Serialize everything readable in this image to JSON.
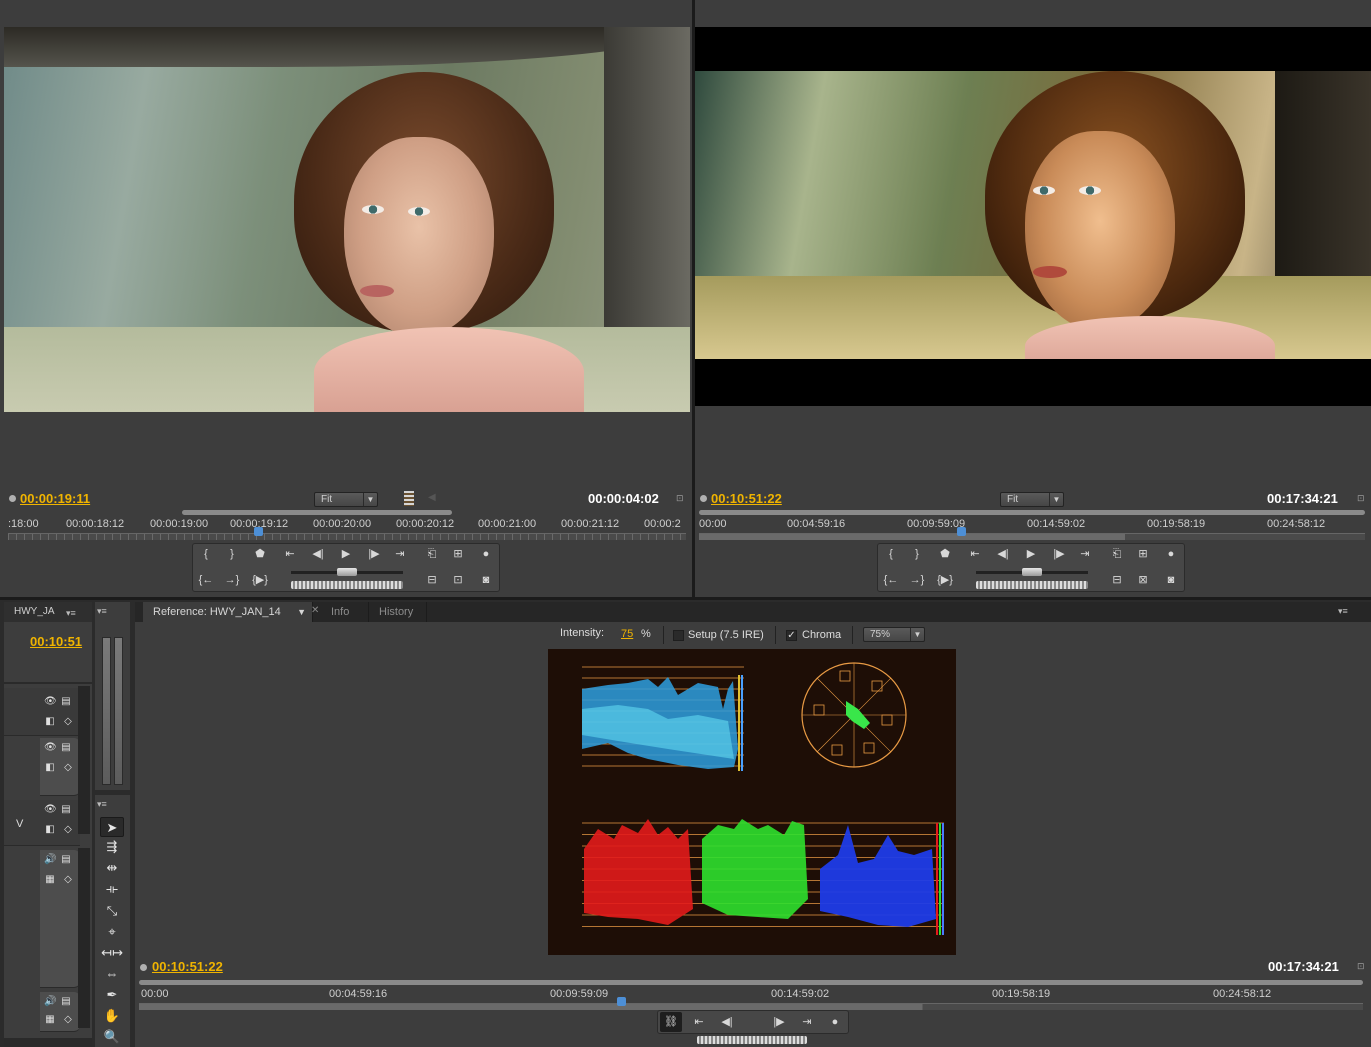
{
  "colors": {
    "accent_timecode": "#f0b400",
    "playhead": "#4d8fd6",
    "scope_bg": "#1e0e06",
    "scope_grid": "#e89a44",
    "luma_wave": "#37c8f0",
    "red_wave": "#e21b1b",
    "green_wave": "#2ee02e",
    "blue_wave": "#1f3ce8"
  },
  "source_monitor": {
    "current_timecode": "00:00:19:11",
    "duration": "00:00:04:02",
    "zoom_label": "Fit",
    "ruler_labels": [
      ":18:00",
      "00:00:18:12",
      "00:00:19:00",
      "00:00:19:12",
      "00:00:20:00",
      "00:00:20:12",
      "00:00:21:00",
      "00:00:21:12",
      "00:00:2"
    ],
    "icons": [
      "drag-video-only-icon",
      "drag-audio-only-icon"
    ]
  },
  "program_monitor": {
    "current_timecode": "00:10:51:22",
    "duration": "00:17:34:21",
    "zoom_label": "Fit",
    "ruler_labels": [
      "00:00",
      "00:04:59:16",
      "00:09:59:09",
      "00:14:59:02",
      "00:19:58:19",
      "00:24:58:12"
    ]
  },
  "timeline": {
    "tab_label": "HWY_JA",
    "timecode": "00:10:51",
    "track_label_v": "V"
  },
  "reference_monitor": {
    "tabs": [
      "Reference: HWY_JAN_14",
      "Info",
      "History"
    ],
    "intensity_label": "Intensity:",
    "intensity_value": "75",
    "intensity_unit": "%",
    "setup_label": "Setup (7.5 IRE)",
    "setup_checked": false,
    "chroma_label": "Chroma",
    "chroma_checked": true,
    "scope_zoom": "75%",
    "current_timecode": "00:10:51:22",
    "duration": "00:17:34:21",
    "ruler_labels": [
      "00:00",
      "00:04:59:16",
      "00:09:59:09",
      "00:14:59:02",
      "00:19:58:19",
      "00:24:58:12"
    ]
  }
}
